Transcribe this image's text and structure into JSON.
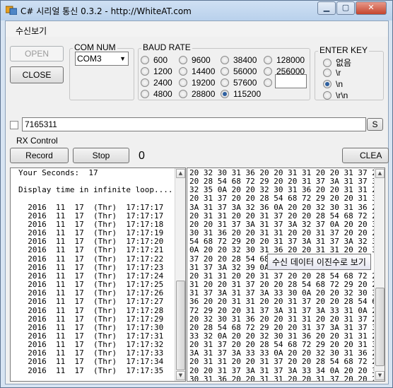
{
  "window": {
    "title": "C# 시리얼 통신 0.3.2 - http://WhiteAT.com"
  },
  "menu": {
    "items": [
      "수신보기"
    ]
  },
  "buttons": {
    "open": "OPEN",
    "close": "CLOSE",
    "record": "Record",
    "stop": "Stop",
    "s": "S",
    "clear": "CLEA"
  },
  "com": {
    "label": "COM NUM",
    "selected": "COM3"
  },
  "baud": {
    "label": "BAUD RATE",
    "options": [
      "600",
      "9600",
      "38400",
      "128000",
      "1200",
      "14400",
      "56000",
      "256000",
      "2400",
      "19200",
      "57600",
      "",
      "4800",
      "28800",
      "115200"
    ],
    "selected": "115200"
  },
  "enter_key": {
    "label": "ENTER KEY",
    "options": [
      "없음",
      "\\r",
      "\\n",
      "\\r\\n"
    ],
    "selected": "\\n"
  },
  "send": {
    "value": "7165311"
  },
  "rx": {
    "label": "RX Control",
    "count": "0"
  },
  "log_text": "Your Seconds:  17\n\nDisplay time in infinite loop....\n\n  2016  11  17  (Thr)  17:17:17\n  2016  11  17  (Thr)  17:17:17\n  2016  11  17  (Thr)  17:17:18\n  2016  11  17  (Thr)  17:17:19\n  2016  11  17  (Thr)  17:17:20\n  2016  11  17  (Thr)  17:17:21\n  2016  11  17  (Thr)  17:17:22\n  2016  11  17  (Thr)  17:17:23\n  2016  11  17  (Thr)  17:17:24\n  2016  11  17  (Thr)  17:17:25\n  2016  11  17  (Thr)  17:17:26\n  2016  11  17  (Thr)  17:17:27\n  2016  11  17  (Thr)  17:17:28\n  2016  11  17  (Thr)  17:17:29\n  2016  11  17  (Thr)  17:17:30\n  2016  11  17  (Thr)  17:17:31\n  2016  11  17  (Thr)  17:17:32\n  2016  11  17  (Thr)  17:17:33\n  2016  11  17  (Thr)  17:17:34\n  2016  11  17  (Thr)  17:17:35",
  "hex_text": "20 32 30 31 36 20 20 31 31 20 20 31 37 20\n20 28 54 68 72 29 20 20 31 37 3A 31 37 3A\n32 35 0A 20 20 32 30 31 36 20 20 31 31 20\n20 31 37 20 20 28 54 68 72 29 20 20 31 37\n3A 31 37 3A 32 36 0A 20 20 32 30 31 36 20\n20 31 31 20 20 31 37 20 20 28 54 68 72 29\n20 20 31 37 3A 31 37 3A 32 37 0A 20 20 32\n30 31 36 20 20 31 31 20 20 31 37 20 20 28\n54 68 72 29 20 20 31 37 3A 31 37 3A 32 38\n0A 20 20 32 30 31 36 20 20 31 31 20 20 31\n37 20 20 28 54 68\n31 37 3A 32 39 0A\n20 31 31 20 20 31 37 20 20 28 54 68 72 29\n31 20 20 31 37 20 20 28 54 68 72 29 20 20\n31 37 3A 31 37 3A 33 30 0A 20 20 32 30 31\n36 20 20 31 31 20 20 31 37 20 20 28 54 68\n72 29 20 20 31 37 3A 31 37 3A 33 31 0A 20\n20 32 30 31 36 20 20 31 31 20 20 31 37 20\n20 28 54 68 72 29 20 20 31 37 3A 31 37 3A\n33 32 0A 20 20 32 30 31 36 20 20 31 31 20\n20 31 37 20 20 28 54 68 72 29 20 20 31 37\n3A 31 37 3A 33 33 0A 20 20 32 30 31 36 20\n20 31 31 20 20 31 37 20 20 28 54 68 72 29\n20 20 31 37 3A 31 37 3A 33 34 0A 20 20 32\n30 31 36 20 20 31 31 20 20 31 37 20 20 28\n54 68 72 29 20 20 31 37 3A 31 37 3A 33 35",
  "tooltip": "수신 데이터 이진수로 보기"
}
